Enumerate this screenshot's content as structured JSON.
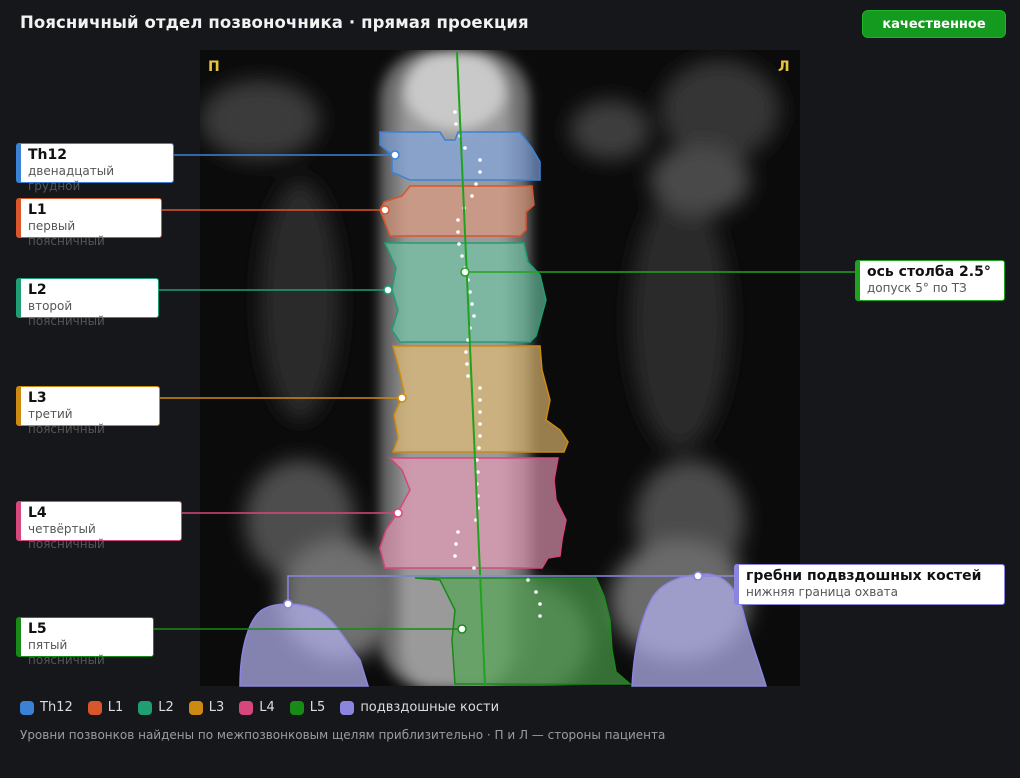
{
  "header": {
    "title": "Поясничный отдел позвоночника · прямая проекция",
    "badge": "качественное",
    "badge_color": "#149a1e"
  },
  "image": {
    "side_right": "П",
    "side_left": "Л"
  },
  "vertebrae": [
    {
      "id": "th12",
      "name": "Th12",
      "desc": "двенадцатый грудной",
      "color": "#3b82d6"
    },
    {
      "id": "l1",
      "name": "L1",
      "desc": "первый поясничный",
      "color": "#d9552b"
    },
    {
      "id": "l2",
      "name": "L2",
      "desc": "второй поясничный",
      "color": "#1f9e72"
    },
    {
      "id": "l3",
      "name": "L3",
      "desc": "третий поясничный",
      "color": "#cc8a12"
    },
    {
      "id": "l4",
      "name": "L4",
      "desc": "четвёртый поясничный",
      "color": "#d6477d"
    },
    {
      "id": "l5",
      "name": "L5",
      "desc": "пятый поясничный",
      "color": "#188a18"
    }
  ],
  "axis": {
    "name": "ось столба 2.5°",
    "desc": "допуск 5° по ТЗ",
    "angle_deg": 2.5,
    "tolerance_deg": 5,
    "color": "#1fa31f"
  },
  "iliac": {
    "name": "гребни подвздошных костей",
    "desc": "нижняя граница охвата",
    "color": "#8a86e0"
  },
  "legend": [
    {
      "label": "Th12",
      "color": "#3b82d6"
    },
    {
      "label": "L1",
      "color": "#d9552b"
    },
    {
      "label": "L2",
      "color": "#1f9e72"
    },
    {
      "label": "L3",
      "color": "#cc8a12"
    },
    {
      "label": "L4",
      "color": "#d6477d"
    },
    {
      "label": "L5",
      "color": "#188a18"
    },
    {
      "label": "подвздошные кости",
      "color": "#8a86e0"
    }
  ],
  "footer": "Уровни позвонков найдены по межпозвонковым щелям приблизительно · П и Л — стороны пациента"
}
